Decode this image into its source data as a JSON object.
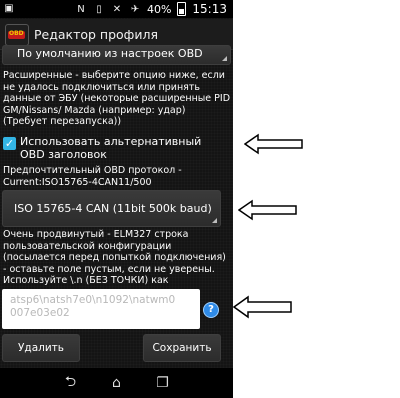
{
  "status_bar": {
    "battery": "40%",
    "time": "15:13",
    "icons": [
      "app-icon",
      "nfc-icon",
      "vibrate-icon",
      "no-signal-icon",
      "airplane-icon",
      "battery-icon"
    ]
  },
  "action_bar": {
    "logo_text": "OBD",
    "title": "Редактор профиля"
  },
  "settings": {
    "protocol_default_value": "По умолчанию из настроек OBD",
    "advanced_description": "Расширенные - выберите опцию ниже, если не удалось подключиться или принять данные от ЭБУ (некоторые расширенные PID GM/Nissans/ Mazda (например: удар) (Требует перезапуска))",
    "alt_header_label": "Использовать альтернативный OBD заголовок",
    "alt_header_checked": true,
    "preferred_protocol_text": "Предпочтительный OBD протокол - Current:ISO15765-4CAN11/500",
    "protocol_select_value": "ISO 15765-4 CAN (11bit 500k baud)",
    "elm_description": "Очень продвинутый - ELM327 строка пользовательской конфигурации (посылается перед попыткой подключения) - оставьте поле пустым, если не уверены. Используйте \\.n (БЕЗ ТОЧКИ) как разделитель команд",
    "init_string_placeholder": "atsp6\\natsh7e0\\n1092\\natwm0 007e03e02",
    "help_icon_glyph": "?"
  },
  "buttons": {
    "delete_label": "Удалить",
    "save_label": "Сохранить"
  },
  "colors": {
    "accent": "#33b5e5",
    "help_blue": "#2f8be8"
  }
}
